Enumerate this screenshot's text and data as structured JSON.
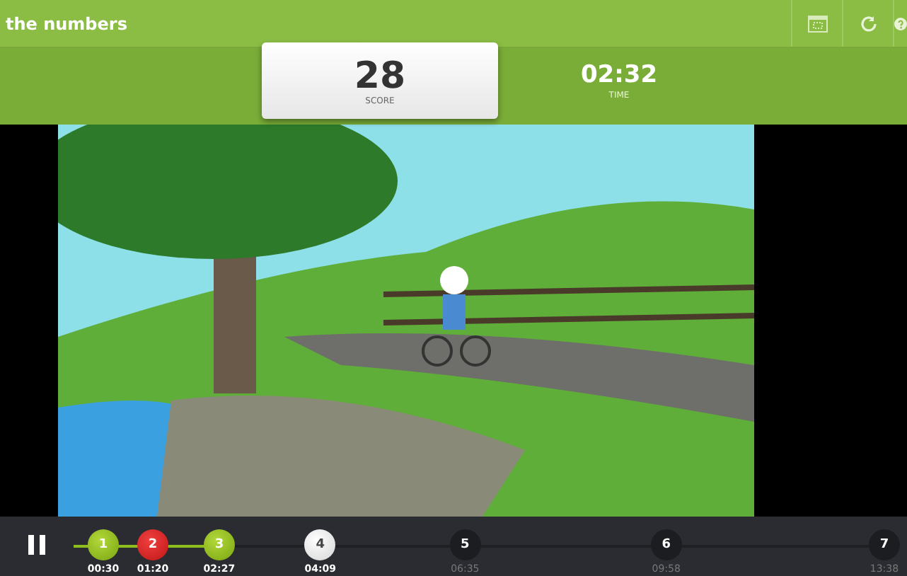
{
  "window": {
    "title": "the numbers"
  },
  "score": {
    "value": "28",
    "label": "SCORE"
  },
  "timer": {
    "value": "02:32",
    "label": "TIME"
  },
  "player": {
    "playing": true
  },
  "timeline": {
    "markers": [
      {
        "number": "1",
        "time": "00:30",
        "kind": "correct"
      },
      {
        "number": "2",
        "time": "01:20",
        "kind": "wrong"
      },
      {
        "number": "3",
        "time": "02:27",
        "kind": "correct"
      },
      {
        "number": "4",
        "time": "04:09",
        "kind": "current"
      },
      {
        "number": "5",
        "time": "06:35",
        "kind": "upcoming"
      },
      {
        "number": "6",
        "time": "09:58",
        "kind": "upcoming"
      },
      {
        "number": "7",
        "time": "13:38",
        "kind": "upcoming"
      }
    ]
  }
}
